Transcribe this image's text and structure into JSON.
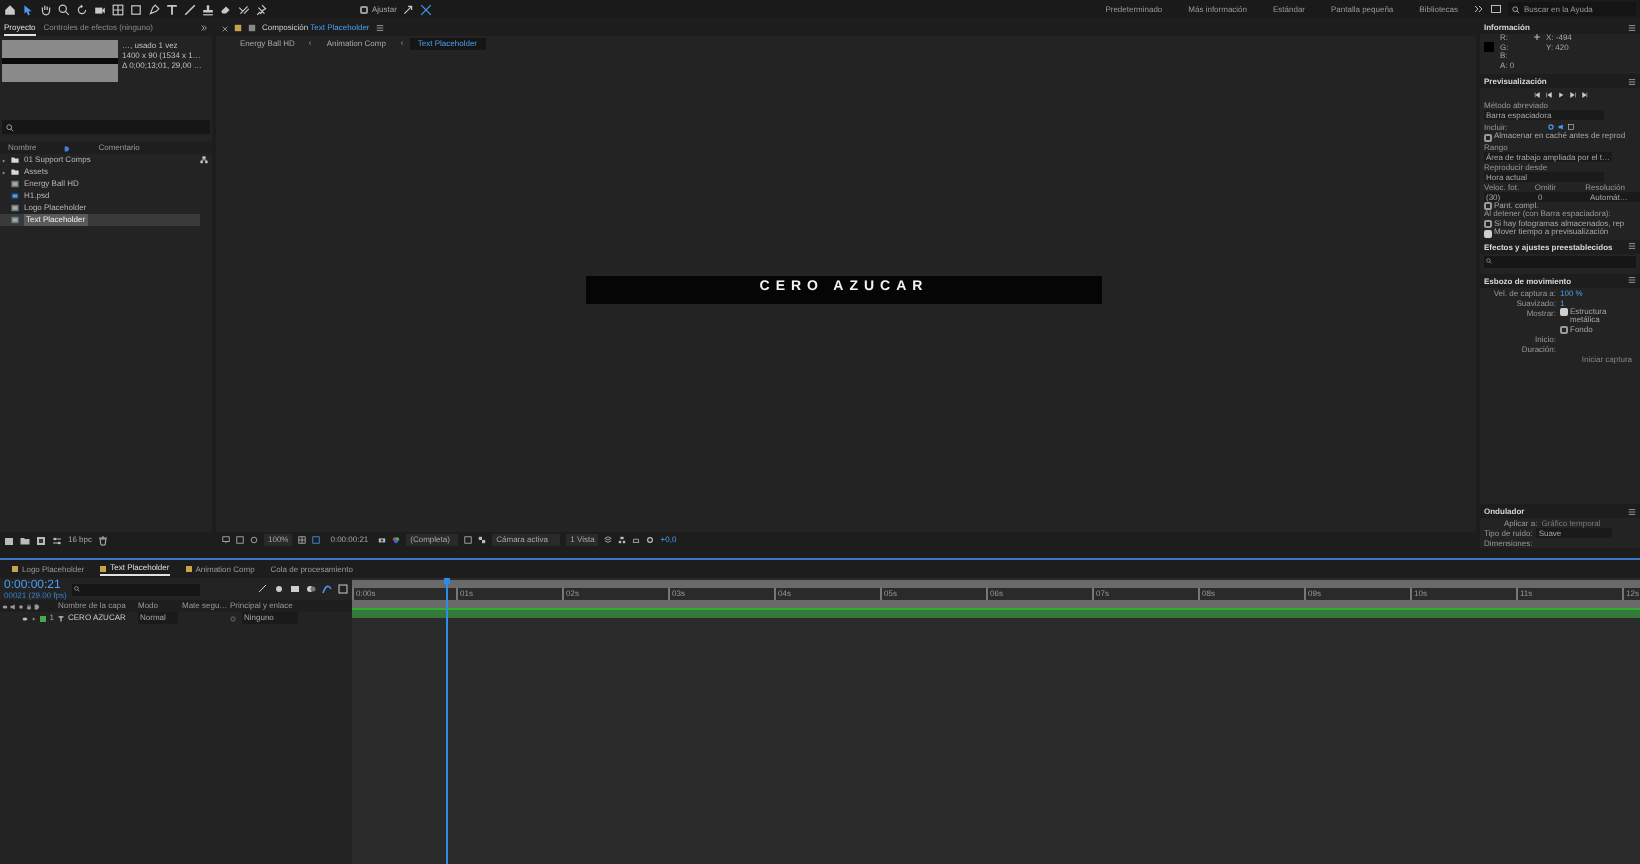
{
  "toolbar": {
    "snap_label": "Ajustar",
    "snap_checked": false,
    "workspaces": [
      "Predeterminado",
      "Más información",
      "Estándar",
      "Pantalla pequeña",
      "Bibliotecas"
    ],
    "search": {
      "placeholder": "Buscar en la Ayuda"
    }
  },
  "project_panel": {
    "tabs": [
      {
        "label": "Proyecto",
        "selected": true
      },
      {
        "label": "Controles de efectos (ninguno)",
        "selected": false
      }
    ],
    "info_lines": [
      "…, usado 1 vez",
      "1400 x 90 (1534 x 1…",
      "Δ 0;00;13;01, 29,00 …"
    ],
    "columns": [
      "Nombre",
      "Comentario"
    ],
    "items": [
      {
        "kind": "folder",
        "name": "01 Support Comps",
        "selected": false
      },
      {
        "kind": "folder",
        "name": "Assets",
        "selected": false
      },
      {
        "kind": "comp",
        "name": "Energy Ball HD",
        "selected": false
      },
      {
        "kind": "footage",
        "name": "H1.psd",
        "selected": false
      },
      {
        "kind": "comp",
        "name": "Logo Placeholder",
        "selected": false
      },
      {
        "kind": "comp",
        "name": "Text Placeholder",
        "selected": true
      }
    ],
    "bit_depth": "16 bpc"
  },
  "composition_panel": {
    "tab_prefix": "Composición",
    "tab_name": "Text Placeholder",
    "breadcrumbs": [
      {
        "label": "Energy Ball HD",
        "selected": false
      },
      {
        "label": "Animation Comp",
        "selected": false
      },
      {
        "label": "Text Placeholder",
        "selected": true
      }
    ],
    "canvas_text": "CERO AZUCAR",
    "viewer_bar": {
      "zoom": "100%",
      "timecode": "0:00:00:21",
      "resolution": "(Completa)",
      "camera": "Cámara activa",
      "views": "1 Vista",
      "exposure": "+0,0"
    }
  },
  "info_panel": {
    "title": "Información",
    "color_labels": [
      "R:",
      "G:",
      "B:",
      "A: 0"
    ],
    "coords": [
      "X: -494",
      "Y: 420"
    ]
  },
  "preview_panel": {
    "title": "Previsualización",
    "shortcut_label": "Método abreviado",
    "shortcut": "Barra espaciadora",
    "include_label": "Incluir:",
    "cache_check": {
      "label": "Almacenar en caché antes de reprod",
      "checked": false
    },
    "range_label": "Rango",
    "range": "Área de trabajo ampliada por el t…",
    "play_from_label": "Reproducir desde",
    "play_from": "Hora actual",
    "settings_labels": [
      "Veloc. fot.",
      "Omitir",
      "Resolución"
    ],
    "settings_values": [
      "(30)",
      "0",
      "Automát…"
    ],
    "fullscreen": {
      "label": "Pant. compl.",
      "checked": false
    },
    "on_stop_label": "Al detener (con Barra espaciadora):",
    "on_stop_checks": [
      {
        "label": "Si hay fotogramas almacenados, rep",
        "checked": false
      },
      {
        "label": "Mover tiempo a previsualización",
        "checked": true
      }
    ]
  },
  "effects_panel": {
    "title": "Efectos y ajustes preestablecidos"
  },
  "motion_sketch": {
    "title": "Esbozo de movimiento",
    "capture_label": "Vel. de captura a:",
    "capture_value": "100 %",
    "smoothing_label": "Suavizado:",
    "smoothing_value": "1",
    "show_label": "Mostrar:",
    "show_checks": [
      {
        "label": "Estructura metálica",
        "checked": true
      },
      {
        "label": "Fondo",
        "checked": false
      }
    ],
    "start_label": "Inicio:",
    "duration_label": "Duración:",
    "capture_button": {
      "label": "Iniciar captura",
      "disabled": true
    }
  },
  "wiggler": {
    "title": "Ondulador",
    "apply_label": "Aplicar a:",
    "apply_value": "Gráfico temporal",
    "noise_label": "Tipo de ruido:",
    "noise_value": "Suave",
    "dimensions_label": "Dimensiones:"
  },
  "timeline": {
    "tabs": [
      {
        "label": "Logo Placeholder",
        "selected": false
      },
      {
        "label": "Text Placeholder",
        "selected": true
      },
      {
        "label": "Animation Comp",
        "selected": false
      },
      {
        "label": "Cola de procesamiento",
        "selected": false
      }
    ],
    "timecode": "0:00:00:21",
    "frame_info": "00021 (29.00 fps)",
    "columns": [
      "Nombre de la capa",
      "Modo",
      "Mate segu…",
      "Principal y enlace"
    ],
    "layers": [
      {
        "number": "1",
        "name": "CERO AZUCAR",
        "mode": "Normal",
        "parent": "Ninguno",
        "color": "#3fae49"
      }
    ],
    "ruler": [
      "0:00s",
      "01s",
      "02s",
      "03s",
      "04s",
      "05s",
      "06s",
      "07s",
      "08s",
      "09s",
      "10s",
      "11s",
      "12s"
    ],
    "playhead": {
      "level": 0.073
    }
  }
}
